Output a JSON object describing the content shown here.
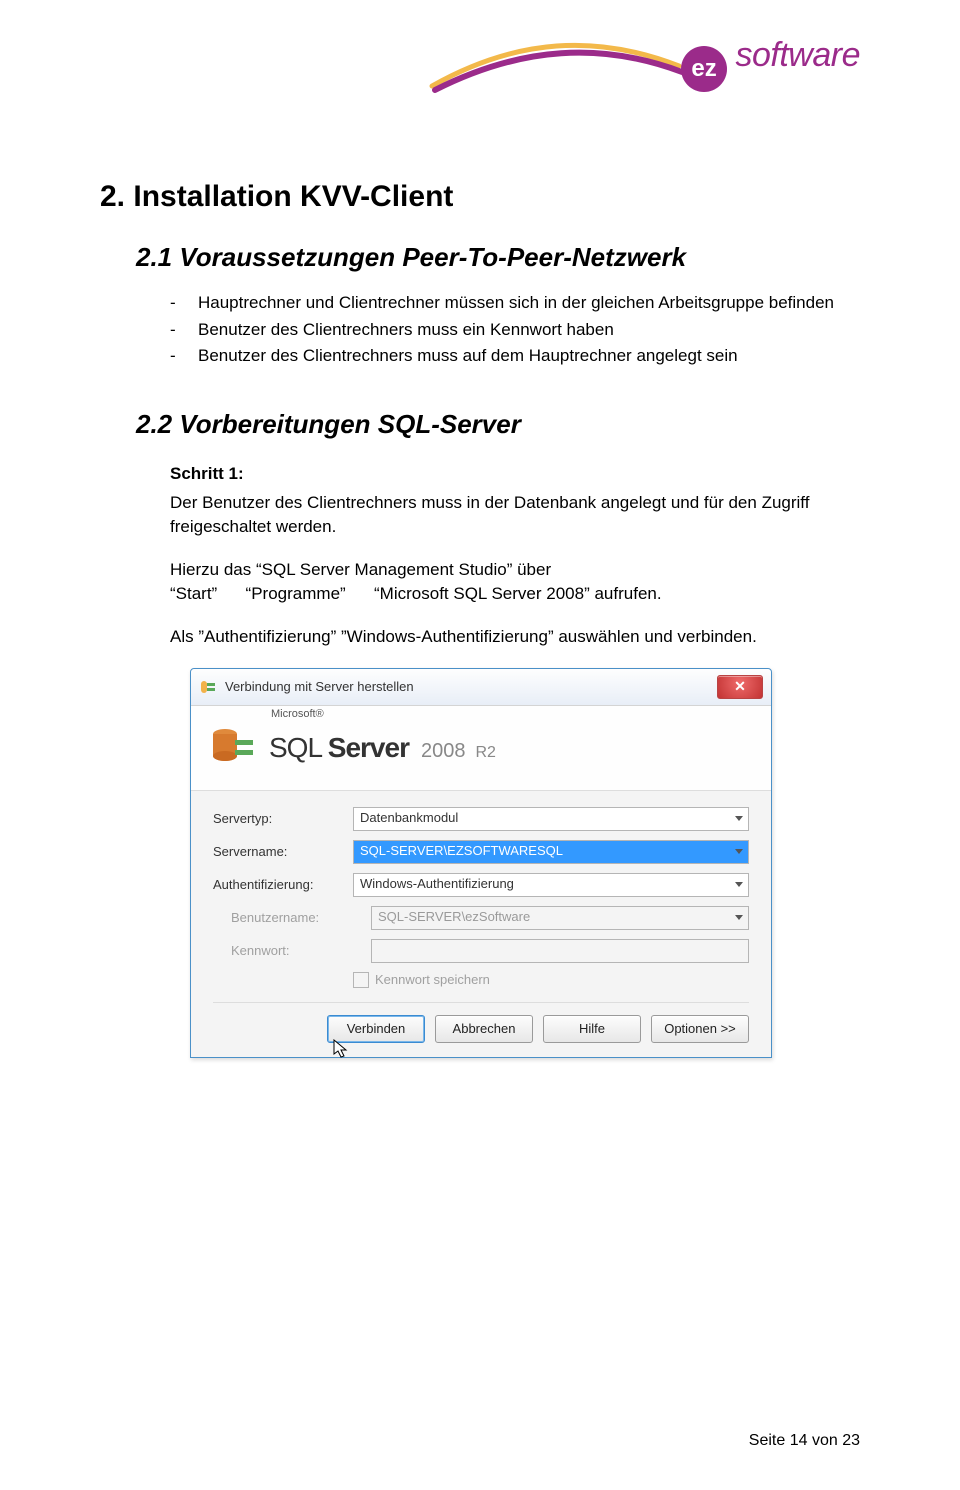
{
  "logo": {
    "ez": "ez",
    "software": "software"
  },
  "headings": {
    "h1": "2. Installation KVV-Client",
    "h2a": "2.1  Voraussetzungen Peer-To-Peer-Netzwerk",
    "h2b": "2.2  Vorbereitungen SQL-Server"
  },
  "bullets": [
    "Hauptrechner und Clientrechner müssen sich in der gleichen Arbeitsgruppe befinden",
    "Benutzer des Clientrechners muss ein Kennwort haben",
    "Benutzer des Clientrechners muss auf dem Hauptrechner angelegt sein"
  ],
  "step": {
    "title": "Schritt 1:",
    "p1": "Der Benutzer des Clientrechners muss in der Datenbank angelegt und für den Zugriff freigeschaltet werden.",
    "p2a": "Hierzu das “SQL Server Management Studio” über",
    "p2b": "“Start”      “Programme”      “Microsoft SQL Server 2008” aufrufen.",
    "p3": "Als ”Authentifizierung” ”Windows-Authentifizierung” auswählen und verbinden."
  },
  "dialog": {
    "title": "Verbindung mit Server herstellen",
    "brand_ms": "Microsoft®",
    "brand_sql_a": "SQL ",
    "brand_sql_b": "Server",
    "brand_year": "2008",
    "brand_r2": "R2",
    "labels": {
      "servertyp": "Servertyp:",
      "servername": "Servername:",
      "auth": "Authentifizierung:",
      "benutzer": "Benutzername:",
      "kennwort": "Kennwort:",
      "speichern": "Kennwort speichern"
    },
    "values": {
      "servertyp": "Datenbankmodul",
      "servername": "SQL-SERVER\\EZSOFTWARESQL",
      "auth": "Windows-Authentifizierung",
      "benutzer": "SQL-SERVER\\ezSoftware",
      "kennwort": ""
    },
    "buttons": {
      "verbinden": "Verbinden",
      "abbrechen": "Abbrechen",
      "hilfe": "Hilfe",
      "optionen": "Optionen >>"
    }
  },
  "footer": "Seite 14 von 23"
}
